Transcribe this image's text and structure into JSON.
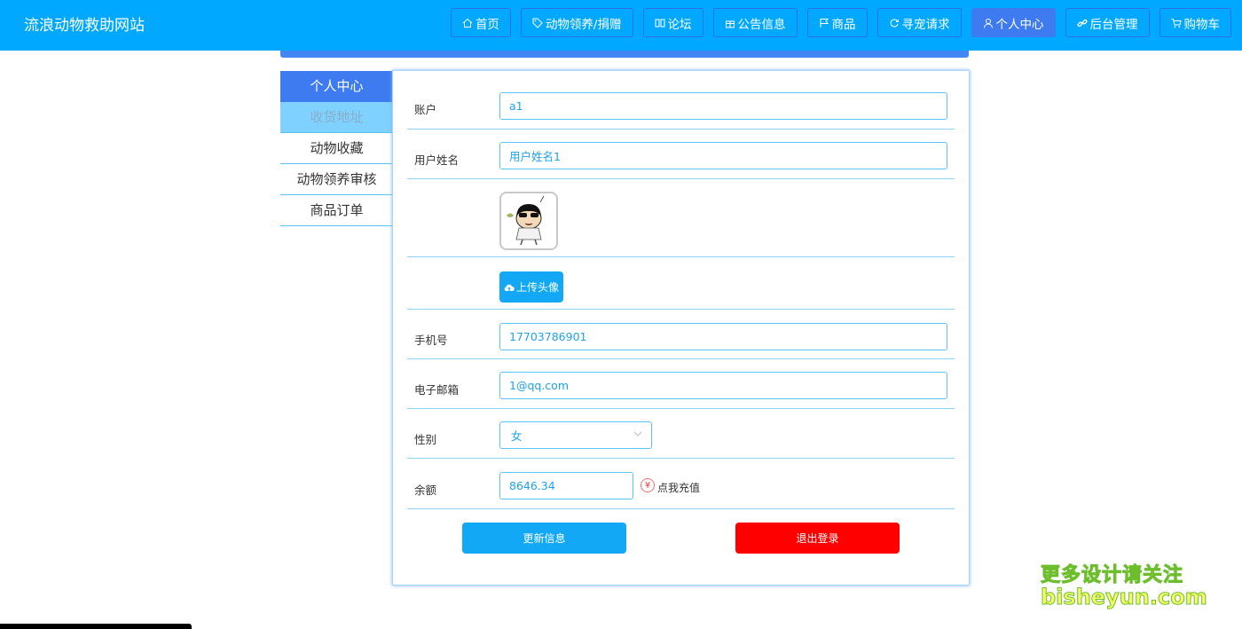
{
  "site": {
    "title": "流浪动物救助网站"
  },
  "nav": [
    {
      "label": "首页",
      "icon": "home-icon"
    },
    {
      "label": "动物领养/捐赠",
      "icon": "tag-icon"
    },
    {
      "label": "论坛",
      "icon": "book-icon"
    },
    {
      "label": "公告信息",
      "icon": "gift-icon"
    },
    {
      "label": "商品",
      "icon": "flag-icon"
    },
    {
      "label": "寻宠请求",
      "icon": "refresh-icon"
    },
    {
      "label": "个人中心",
      "icon": "user-icon",
      "active": true
    },
    {
      "label": "后台管理",
      "icon": "link-icon"
    },
    {
      "label": "购物车",
      "icon": "cart-icon"
    }
  ],
  "sidebar": [
    {
      "label": "个人中心",
      "state": "active"
    },
    {
      "label": "收货地址",
      "state": "hover"
    },
    {
      "label": "动物收藏"
    },
    {
      "label": "动物领养审核"
    },
    {
      "label": "商品订单"
    }
  ],
  "form": {
    "account": {
      "label": "账户",
      "value": "a1"
    },
    "username": {
      "label": "用户姓名",
      "value": "用户姓名1"
    },
    "upload_label": "上传头像",
    "phone": {
      "label": "手机号",
      "value": "17703786901"
    },
    "email": {
      "label": "电子邮箱",
      "value": "1@qq.com"
    },
    "gender": {
      "label": "性别",
      "value": "女"
    },
    "balance": {
      "label": "余额",
      "value": "8646.34",
      "recharge": "点我充值",
      "recharge_icon": "¥"
    },
    "save_label": "更新信息",
    "logout_label": "退出登录"
  },
  "watermark": {
    "line1": "更多设计请关注",
    "line2": "bisheyun.com"
  },
  "colors": {
    "primary": "#00a8ff",
    "accent": "#3e7bf0",
    "danger": "#ff0000"
  }
}
